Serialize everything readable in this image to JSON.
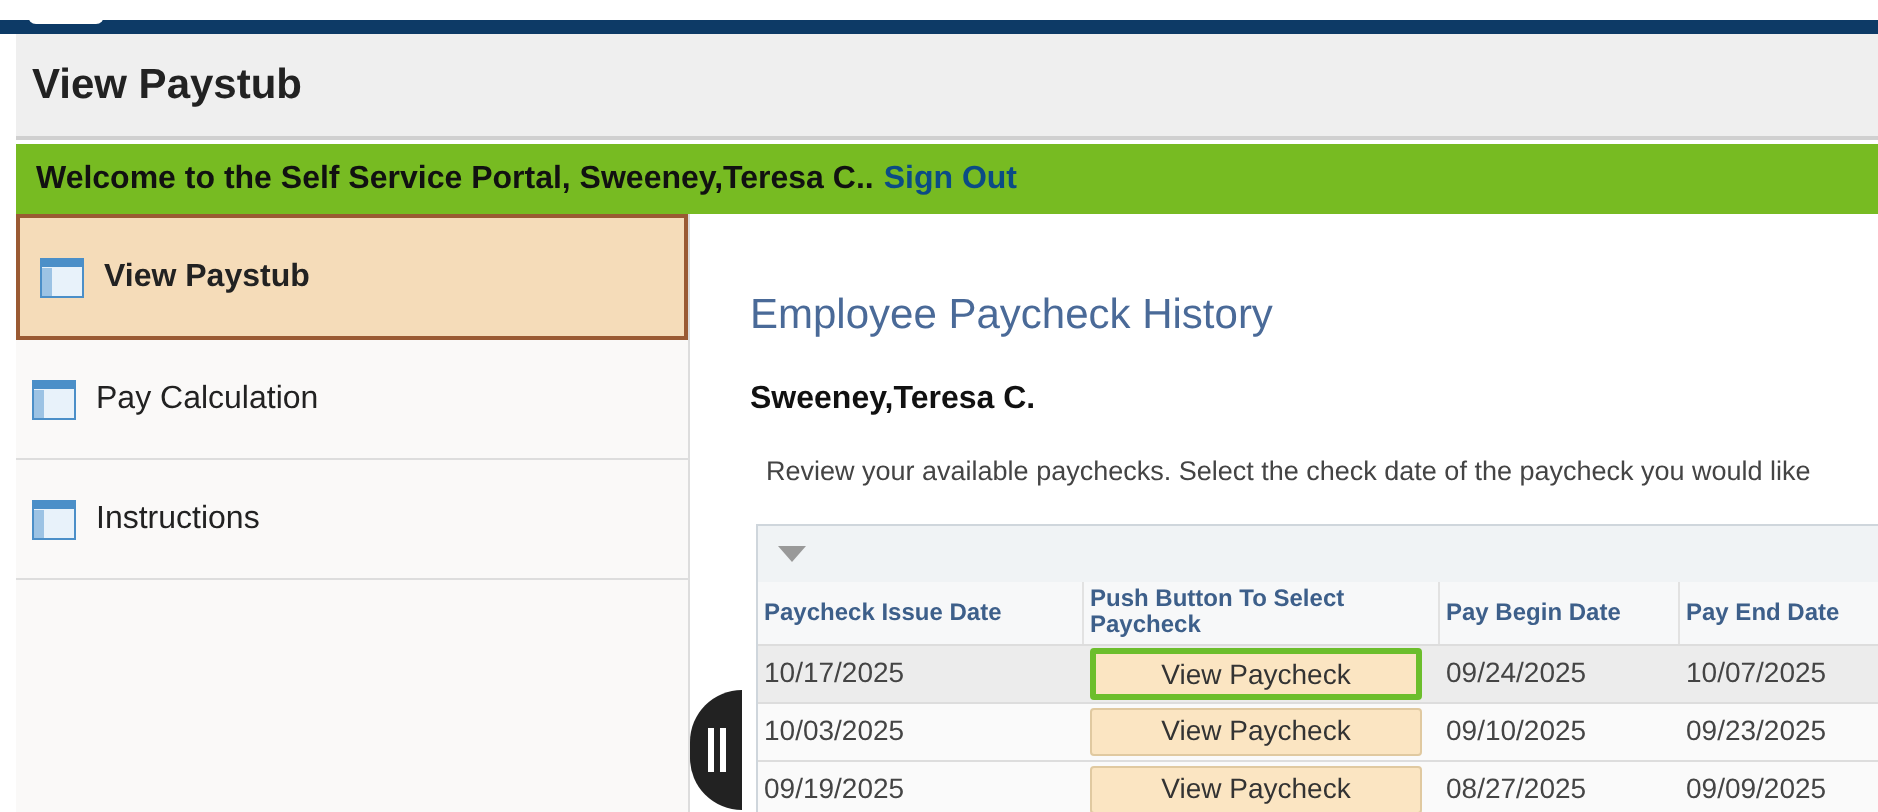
{
  "page_title": "View Paystub",
  "welcome": {
    "text": "Welcome to the Self Service Portal, Sweeney,Teresa C..",
    "link": "Sign Out"
  },
  "sidebar": {
    "items": [
      {
        "label": "View Paystub",
        "selected": true
      },
      {
        "label": "Pay Calculation",
        "selected": false
      },
      {
        "label": "Instructions",
        "selected": false
      }
    ]
  },
  "content": {
    "heading": "Employee Paycheck History",
    "employee": "Sweeney,Teresa C.",
    "instructions": "Review your available paychecks. Select the check date of the paycheck you would like"
  },
  "table": {
    "columns": [
      "Paycheck Issue Date",
      "Push Button To Select Paycheck",
      "Pay Begin Date",
      "Pay End Date"
    ],
    "rows": [
      {
        "issue": "10/17/2025",
        "button": "View Paycheck",
        "begin": "09/24/2025",
        "end": "10/07/2025",
        "selected": true,
        "highlighted": true
      },
      {
        "issue": "10/03/2025",
        "button": "View Paycheck",
        "begin": "09/10/2025",
        "end": "09/23/2025",
        "selected": false,
        "highlighted": false
      },
      {
        "issue": "09/19/2025",
        "button": "View Paycheck",
        "begin": "08/27/2025",
        "end": "09/09/2025",
        "selected": false,
        "highlighted": false
      }
    ]
  }
}
